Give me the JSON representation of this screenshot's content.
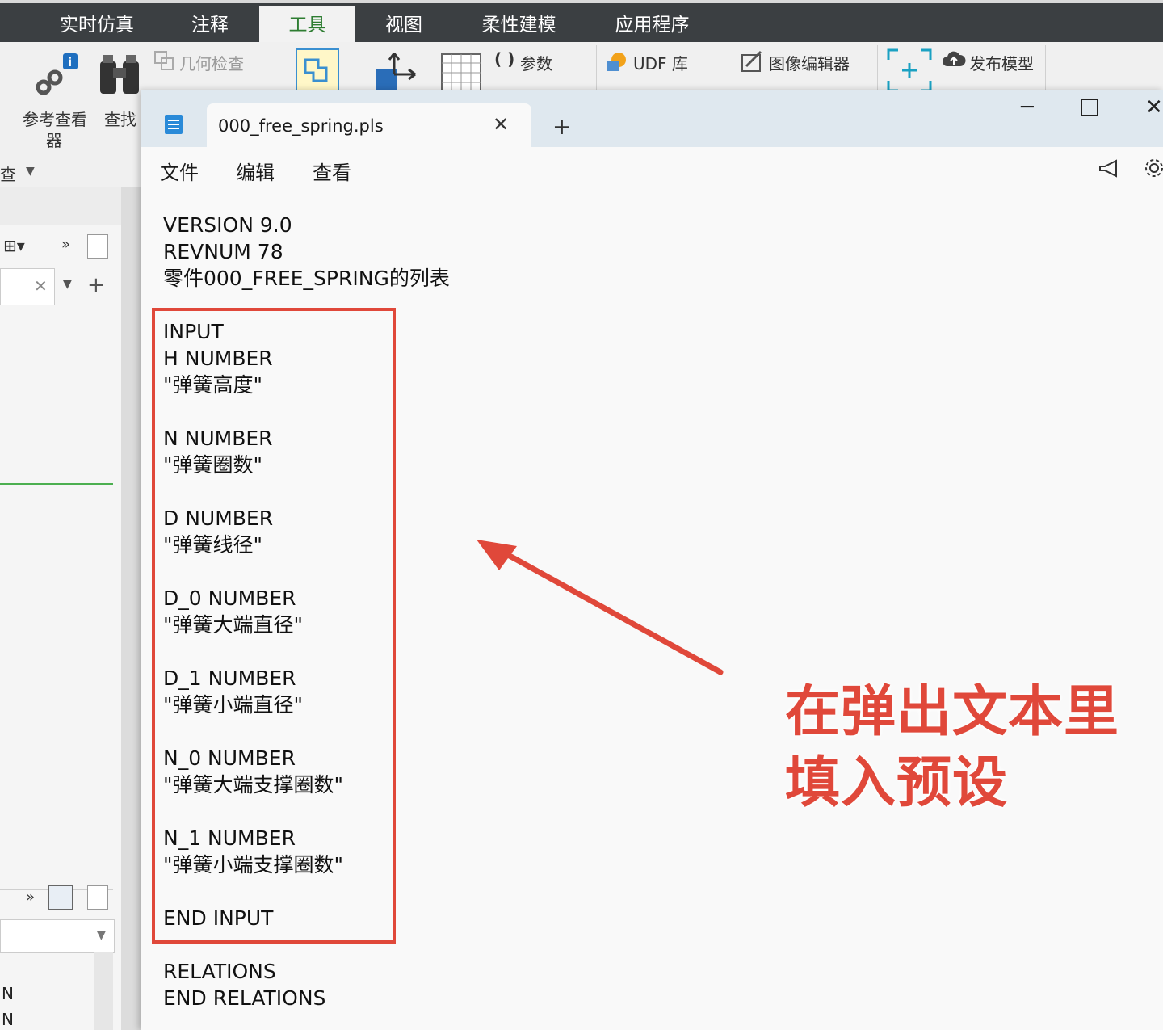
{
  "cad": {
    "menu_tabs": [
      "实时仿真",
      "注释",
      "工具",
      "视图",
      "柔性建模",
      "应用程序"
    ],
    "active_tab": "工具",
    "ribbon": {
      "ref_viewer": "参考查看",
      "ref_viewer_2": "器",
      "find": "查找",
      "geometry_check": "几何检查",
      "params": "参数",
      "udf_lib": "UDF 库",
      "image_editor": "图像编辑器",
      "publish_model": "发布模型",
      "investigate_suffix": "查"
    }
  },
  "notepad": {
    "tab_title": "000_free_spring.pls",
    "menu": [
      "文件",
      "编辑",
      "查看"
    ],
    "lines": [
      "VERSION 9.0",
      "REVNUM 78",
      "零件000_FREE_SPRING的列表",
      "",
      "INPUT",
      "H NUMBER",
      "\"弹簧高度\"",
      "",
      "N NUMBER",
      "\"弹簧圈数\"",
      "",
      "D NUMBER",
      "\"弹簧线径\"",
      "",
      "D_0 NUMBER",
      "\"弹簧大端直径\"",
      "",
      "D_1 NUMBER",
      "\"弹簧小端直径\"",
      "",
      "N_0 NUMBER",
      "\"弹簧大端支撑圈数\"",
      "",
      "N_1 NUMBER",
      "\"弹簧小端支撑圈数\"",
      "",
      "END INPUT",
      "",
      "RELATIONS",
      "END RELATIONS"
    ]
  },
  "annotation": {
    "caption_line1": "在弹出文本里",
    "caption_line2": "填入预设",
    "color": "#e0483a"
  },
  "left_panel": {
    "row1": "N",
    "row2": "N"
  }
}
